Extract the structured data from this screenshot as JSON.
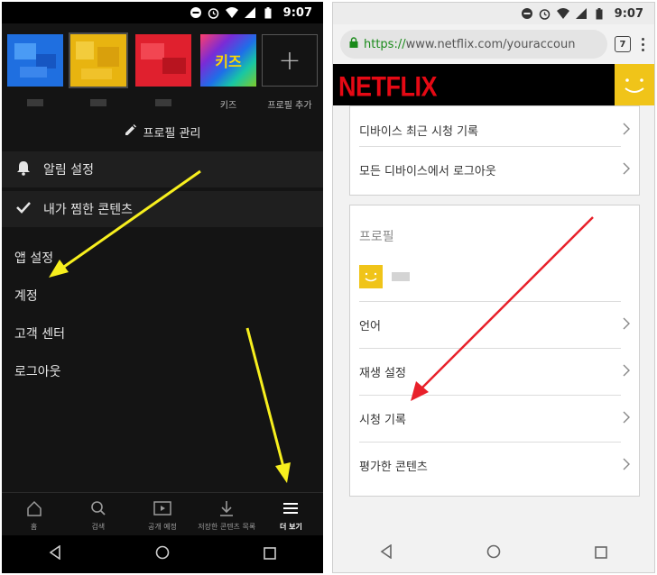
{
  "left": {
    "status": {
      "time": "9:07"
    },
    "profiles": [
      {
        "label": "",
        "color": "#1f6fe0"
      },
      {
        "label": "",
        "color": "#e8b410"
      },
      {
        "label": "",
        "color": "#e0202e"
      },
      {
        "label": "키즈",
        "kids_text": "키즈"
      },
      {
        "label": "프로필 추가",
        "add_symbol": "+"
      }
    ],
    "manage_profiles": "프로필 관리",
    "dark_menu": [
      {
        "label": "알림 설정",
        "icon": "bell-icon"
      },
      {
        "label": "내가 찜한 콘텐츠",
        "icon": "check-icon"
      }
    ],
    "menu": [
      "앱 설정",
      "계정",
      "고객 센터",
      "로그아웃"
    ],
    "bottom_nav": [
      {
        "label": "홈",
        "icon": "home-icon",
        "active": false
      },
      {
        "label": "검색",
        "icon": "search-icon",
        "active": false
      },
      {
        "label": "공개 예정",
        "icon": "play-box-icon",
        "active": false
      },
      {
        "label": "저장한 콘텐츠 목록",
        "icon": "download-icon",
        "active": false
      },
      {
        "label": "더 보기",
        "icon": "menu-icon",
        "active": true
      }
    ],
    "arrow_color": "#f7ef1e"
  },
  "right": {
    "status": {
      "time": "9:07"
    },
    "url": {
      "scheme": "https://",
      "rest": "www.netflix.com/youraccoun"
    },
    "tab_count": "7",
    "logo": "NETFLIX",
    "brand_color": "#e50914",
    "settings_rows": [
      "디바이스 최근 시청 기록",
      "모든 디바이스에서 로그아웃"
    ],
    "profile_section": {
      "title": "프로필",
      "rows": [
        "언어",
        "재생 설정",
        "시청 기록",
        "평가한 콘텐츠"
      ]
    },
    "arrow_color": "#e8202a"
  }
}
